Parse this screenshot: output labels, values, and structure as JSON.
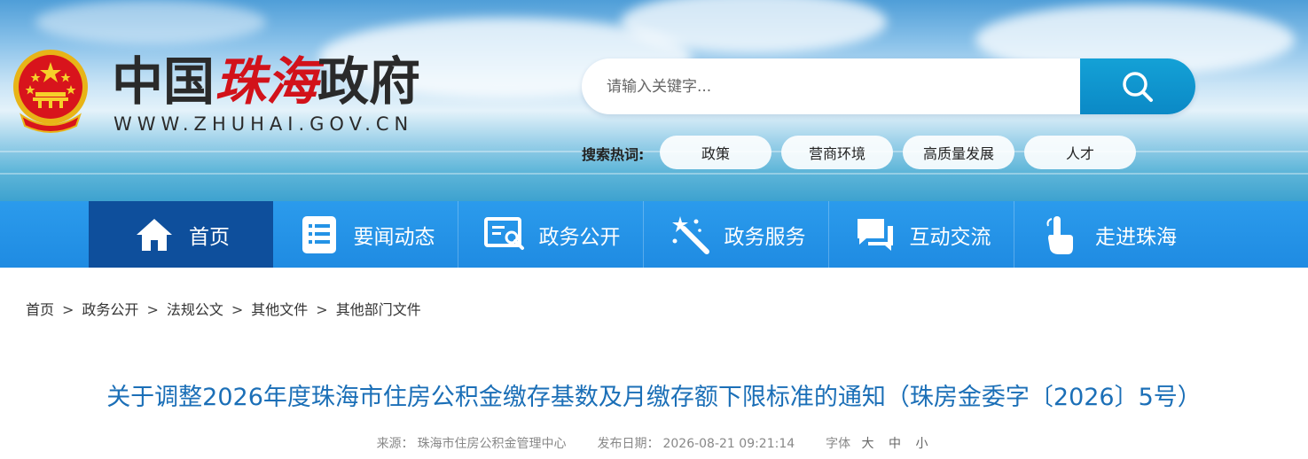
{
  "header": {
    "logo_cn_part1": "中国",
    "logo_cn_part2": "珠海",
    "logo_cn_part3": "政府",
    "logo_en": "WWW.ZHUHAI.GOV.CN"
  },
  "search": {
    "placeholder": "请输入关键字...",
    "hot_label": "搜索热词:",
    "hot_words": [
      "政策",
      "营商环境",
      "高质量发展",
      "人才"
    ]
  },
  "nav": {
    "items": [
      {
        "label": "首页",
        "icon": "home-icon"
      },
      {
        "label": "要闻动态",
        "icon": "news-list-icon"
      },
      {
        "label": "政务公开",
        "icon": "public-info-icon"
      },
      {
        "label": "政务服务",
        "icon": "magic-wand-icon"
      },
      {
        "label": "互动交流",
        "icon": "chat-icon"
      },
      {
        "label": "走进珠海",
        "icon": "pointer-hand-icon"
      }
    ]
  },
  "breadcrumb": {
    "items": [
      "首页",
      "政务公开",
      "法规公文",
      "其他文件",
      "其他部门文件"
    ],
    "separator": ">"
  },
  "article": {
    "title": "关于调整2026年度珠海市住房公积金缴存基数及月缴存额下限标准的通知（珠房金委字〔2026〕5号）",
    "source_label": "来源：",
    "source": "珠海市住房公积金管理中心",
    "date_label": "发布日期：",
    "date": "2026-08-21 09:21:14",
    "font_label": "字体",
    "font_large": "大",
    "font_medium": "中",
    "font_small": "小"
  },
  "colors": {
    "nav_bg": "#1f8be2",
    "nav_active": "#0e4f9c",
    "title_color": "#1b6fb7",
    "logo_red": "#d2121a",
    "search_button": "#0b89c6"
  }
}
